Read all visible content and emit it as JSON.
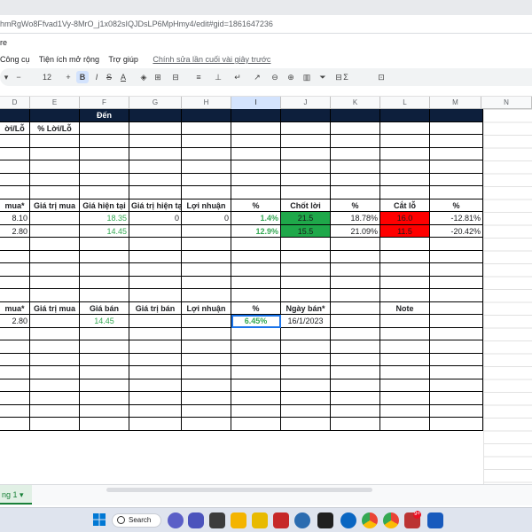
{
  "browser": {
    "url": "hmRgWo8Ffvad1Vy-8MrO_j1x082sIQJDsLP6MpHmy4/edit#gid=1861647236"
  },
  "app": {
    "title_fragment": "re",
    "menu": [
      "Công cụ",
      "Tiện ích mở rộng",
      "Trợ giúp"
    ],
    "last_edit": "Chính sửa lần cuối vài giây trước"
  },
  "toolbar": {
    "font_size": "12",
    "bold": "B",
    "italic": "I",
    "strike": "S",
    "text_color": "A"
  },
  "columns": [
    "D",
    "E",
    "F",
    "G",
    "H",
    "I",
    "J",
    "K",
    "L",
    "M",
    "N"
  ],
  "table1": {
    "header": {
      "col_f": "Đến"
    },
    "subheader": {
      "col_d": "ời/Lỗ",
      "col_e": "% Lời/Lỗ"
    }
  },
  "table2": {
    "headers": [
      "mua*",
      "Giá trị mua",
      "Giá hiện tại",
      "Giá trị hiện tại",
      "Lợi nhuận",
      "%",
      "Chốt lời",
      "%",
      "Cắt lỗ",
      "%"
    ],
    "rows": [
      [
        "8.10",
        "",
        "18.35",
        "0",
        "0",
        "1.4%",
        "21.5",
        "18.78%",
        "16.0",
        "-12.81%"
      ],
      [
        "2.80",
        "",
        "14.45",
        "",
        "",
        "12.9%",
        "15.5",
        "21.09%",
        "11.5",
        "-20.42%"
      ]
    ]
  },
  "table3": {
    "headers": [
      "mua*",
      "Giá trị mua",
      "Giá bán",
      "Giá trị bán",
      "Lợi nhuận",
      "%",
      "Ngày bán*",
      "",
      "Note",
      ""
    ],
    "rows": [
      [
        "2.80",
        "",
        "14.45",
        "",
        "",
        "6.45%",
        "16/1/2023",
        "",
        "",
        ""
      ]
    ]
  },
  "sheet_tab": {
    "label": "ng 1"
  },
  "taskbar": {
    "search_label": "Search",
    "notif_count": "9+"
  },
  "colors": {
    "header_bg": "#0d1f3c",
    "take_profit": "#1fa84a",
    "stop_loss": "#ff0000",
    "positive": "#34a853"
  }
}
